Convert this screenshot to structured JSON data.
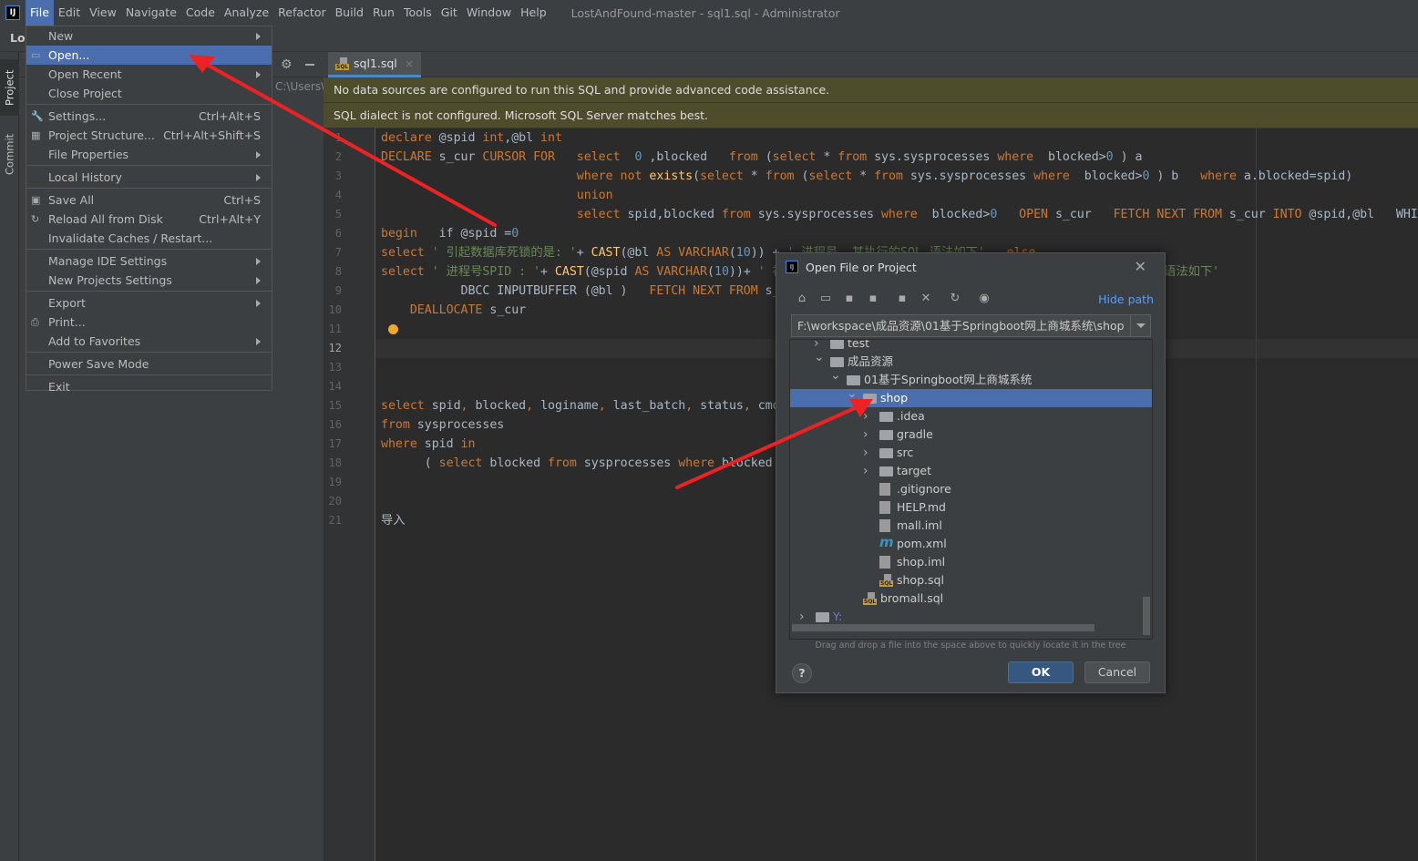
{
  "titlebar": {
    "logo": "IJ",
    "menus": [
      "File",
      "Edit",
      "View",
      "Navigate",
      "Code",
      "Analyze",
      "Refactor",
      "Build",
      "Run",
      "Tools",
      "Git",
      "Window",
      "Help"
    ],
    "window_title": "LostAndFound-master - sql1.sql - Administrator"
  },
  "sidebar": {
    "project_label": "Lo",
    "tabs": [
      "Project",
      "Commit"
    ],
    "path_fragment": "C:\\Users\\"
  },
  "editor": {
    "tab_label": "sql1.sql",
    "banners": [
      "No data sources are configured to run this SQL and provide advanced code assistance.",
      "SQL dialect is not configured. Microsoft SQL Server matches best."
    ],
    "current_line": 12,
    "lines": [
      [
        [
          "k",
          "declare "
        ],
        [
          "t",
          "@spid "
        ],
        [
          "k",
          "int"
        ],
        [
          "t",
          ",@bl "
        ],
        [
          "k",
          "int"
        ]
      ],
      [
        [
          "k",
          "DECLARE "
        ],
        [
          "t",
          "s_cur "
        ],
        [
          "k",
          "CURSOR FOR   select  "
        ],
        [
          "n",
          "0"
        ],
        [
          "t",
          " ,blocked   "
        ],
        [
          "k",
          "from "
        ],
        [
          "t",
          "("
        ],
        [
          "k",
          "select "
        ],
        [
          "t",
          "* "
        ],
        [
          "k",
          "from "
        ],
        [
          "t",
          "sys.sysprocesses "
        ],
        [
          "k",
          "where  "
        ],
        [
          "t",
          "blocked>"
        ],
        [
          "n",
          "0"
        ],
        [
          "t",
          " ) a"
        ]
      ],
      [
        [
          "t",
          "                           "
        ],
        [
          "k",
          "where not "
        ],
        [
          "f",
          "exists"
        ],
        [
          "t",
          "("
        ],
        [
          "k",
          "select "
        ],
        [
          "t",
          "* "
        ],
        [
          "k",
          "from "
        ],
        [
          "t",
          "("
        ],
        [
          "k",
          "select "
        ],
        [
          "t",
          "* "
        ],
        [
          "k",
          "from "
        ],
        [
          "t",
          "sys.sysprocesses "
        ],
        [
          "k",
          "where  "
        ],
        [
          "t",
          "blocked>"
        ],
        [
          "n",
          "0"
        ],
        [
          "t",
          " ) b   "
        ],
        [
          "k",
          "where "
        ],
        [
          "t",
          "a.blocked=spid)"
        ]
      ],
      [
        [
          "t",
          "                           "
        ],
        [
          "k",
          "union"
        ]
      ],
      [
        [
          "t",
          "                           "
        ],
        [
          "k",
          "select "
        ],
        [
          "t",
          "spid,blocked "
        ],
        [
          "k",
          "from "
        ],
        [
          "t",
          "sys.sysprocesses "
        ],
        [
          "k",
          "where  "
        ],
        [
          "t",
          "blocked>"
        ],
        [
          "n",
          "0"
        ],
        [
          "t",
          "   "
        ],
        [
          "k",
          "OPEN "
        ],
        [
          "t",
          "s_cur   "
        ],
        [
          "k",
          "FETCH NEXT FROM "
        ],
        [
          "t",
          "s_cur "
        ],
        [
          "k",
          "INTO "
        ],
        [
          "t",
          "@spid,@bl   WHI"
        ]
      ],
      [
        [
          "k",
          "begin   "
        ],
        [
          "t",
          "if @spid ="
        ],
        [
          "n",
          "0"
        ]
      ],
      [
        [
          "k",
          "select "
        ],
        [
          "s",
          "' 引起数据库死锁的是: '"
        ],
        [
          "t",
          "+ "
        ],
        [
          "f",
          "CAST"
        ],
        [
          "t",
          "(@bl "
        ],
        [
          "k",
          "AS VARCHAR"
        ],
        [
          "t",
          "("
        ],
        [
          "n",
          "10"
        ],
        [
          "t",
          ")) + "
        ],
        [
          "s",
          "' 进程号, 其执行的SQL 语法如下'"
        ],
        [
          "k",
          "   else"
        ]
      ],
      [
        [
          "k",
          "select "
        ],
        [
          "s",
          "' 进程号SPID : '"
        ],
        [
          "t",
          "+ "
        ],
        [
          "f",
          "CAST"
        ],
        [
          "t",
          "(@spid "
        ],
        [
          "k",
          "AS VARCHAR"
        ],
        [
          "t",
          "("
        ],
        [
          "n",
          "10"
        ],
        [
          "t",
          "))+ "
        ],
        [
          "s",
          "' 被                                   其当前进程执行的SQL 语法如下'"
        ]
      ],
      [
        [
          "t",
          "           DBCC INPUTBUFFER (@bl )   "
        ],
        [
          "k",
          "FETCH NEXT FROM "
        ],
        [
          "t",
          "s_cur"
        ]
      ],
      [
        [
          "t",
          "    "
        ],
        [
          "k",
          "DEALLOCATE "
        ],
        [
          "t",
          "s_cur"
        ]
      ],
      [],
      [],
      [],
      [],
      [
        [
          "k",
          "select "
        ],
        [
          "t",
          "spid"
        ],
        [
          "k",
          ", "
        ],
        [
          "t",
          "blocked"
        ],
        [
          "k",
          ", "
        ],
        [
          "t",
          "loginame"
        ],
        [
          "k",
          ", "
        ],
        [
          "t",
          "last_batch"
        ],
        [
          "k",
          ", "
        ],
        [
          "t",
          "status"
        ],
        [
          "k",
          ", "
        ],
        [
          "t",
          "cmd"
        ]
      ],
      [
        [
          "k",
          "from "
        ],
        [
          "t",
          "sysprocesses"
        ]
      ],
      [
        [
          "k",
          "where "
        ],
        [
          "t",
          "spid "
        ],
        [
          "k",
          "in"
        ]
      ],
      [
        [
          "t",
          "      ( "
        ],
        [
          "k",
          "select "
        ],
        [
          "t",
          "blocked "
        ],
        [
          "k",
          "from "
        ],
        [
          "t",
          "sysprocesses "
        ],
        [
          "k",
          "where "
        ],
        [
          "t",
          "blocked"
        ]
      ],
      [],
      [],
      [
        [
          "t",
          "导入"
        ]
      ]
    ]
  },
  "file_menu": {
    "items": [
      {
        "label": "New",
        "submenu": true
      },
      {
        "label": "Open...",
        "icon": "folder-open-icon",
        "highlighted": true
      },
      {
        "label": "Open Recent",
        "submenu": true
      },
      {
        "label": "Close Project",
        "sep_after": true
      },
      {
        "label": "Settings...",
        "icon": "wrench-icon",
        "shortcut": "Ctrl+Alt+S"
      },
      {
        "label": "Project Structure...",
        "icon": "project-structure-icon",
        "shortcut": "Ctrl+Alt+Shift+S"
      },
      {
        "label": "File Properties",
        "submenu": true,
        "sep_after": true
      },
      {
        "label": "Local History",
        "submenu": true,
        "sep_after": true
      },
      {
        "label": "Save All",
        "icon": "save-icon",
        "shortcut": "Ctrl+S"
      },
      {
        "label": "Reload All from Disk",
        "icon": "reload-icon",
        "shortcut": "Ctrl+Alt+Y"
      },
      {
        "label": "Invalidate Caches / Restart...",
        "sep_after": true
      },
      {
        "label": "Manage IDE Settings",
        "submenu": true
      },
      {
        "label": "New Projects Settings",
        "submenu": true,
        "sep_after": true
      },
      {
        "label": "Export",
        "submenu": true
      },
      {
        "label": "Print...",
        "icon": "print-icon"
      },
      {
        "label": "Add to Favorites",
        "submenu": true,
        "sep_after": true
      },
      {
        "label": "Power Save Mode",
        "sep_after": true
      },
      {
        "label": "Exit"
      }
    ]
  },
  "dialog": {
    "title": "Open File or Project",
    "hide_path": "Hide path",
    "toolbar_icons": [
      "home-icon",
      "desktop-icon",
      "project-folder-icon",
      "module-folder-icon",
      "new-folder-icon",
      "delete-icon",
      "refresh-icon",
      "show-hidden-icon"
    ],
    "path": "F:\\workspace\\成品资源\\01基于Springboot网上商城系统\\shop",
    "tree": [
      {
        "name": "test",
        "depth": 2,
        "kind": "folder",
        "chevron": "right"
      },
      {
        "name": "成品资源",
        "depth": 2,
        "kind": "folder",
        "chevron": "down"
      },
      {
        "name": "01基于Springboot网上商城系统",
        "depth": 3,
        "kind": "folder",
        "chevron": "down"
      },
      {
        "name": "shop",
        "depth": 4,
        "kind": "folder",
        "chevron": "down",
        "selected": true
      },
      {
        "name": ".idea",
        "depth": 5,
        "kind": "folder",
        "chevron": "right"
      },
      {
        "name": "gradle",
        "depth": 5,
        "kind": "folder",
        "chevron": "right"
      },
      {
        "name": "src",
        "depth": 5,
        "kind": "folder",
        "chevron": "right"
      },
      {
        "name": "target",
        "depth": 5,
        "kind": "folder",
        "chevron": "right"
      },
      {
        "name": ".gitignore",
        "depth": 5,
        "kind": "file"
      },
      {
        "name": "HELP.md",
        "depth": 5,
        "kind": "md"
      },
      {
        "name": "mall.iml",
        "depth": 5,
        "kind": "file"
      },
      {
        "name": "pom.xml",
        "depth": 5,
        "kind": "maven"
      },
      {
        "name": "shop.iml",
        "depth": 5,
        "kind": "file"
      },
      {
        "name": "shop.sql",
        "depth": 5,
        "kind": "sql"
      },
      {
        "name": "bromall.sql",
        "depth": 4,
        "kind": "sql"
      },
      {
        "name": "Y:",
        "depth": 0,
        "kind": "drive",
        "chevron": "right"
      }
    ],
    "hint": "Drag and drop a file into the space above to quickly locate it in the tree",
    "help": "?",
    "ok": "OK",
    "cancel": "Cancel"
  },
  "annotation_color": "#ee2222"
}
